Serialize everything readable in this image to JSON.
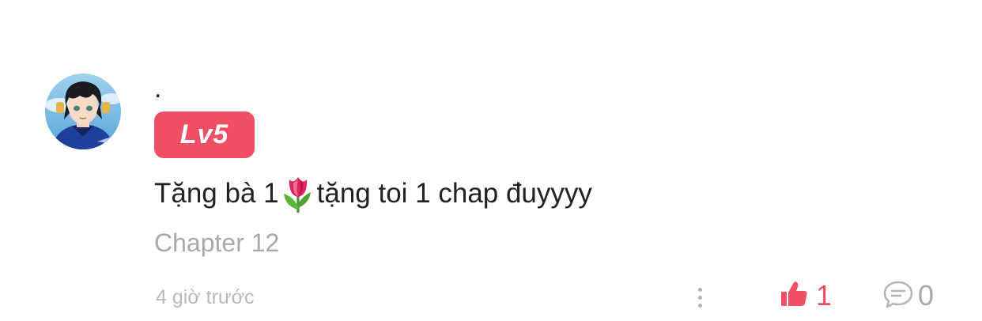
{
  "comment": {
    "avatar_icon": "user-avatar-anime-boy",
    "username": ".",
    "level_badge": "Lv5",
    "text_before_emoji": "Tặng bà 1",
    "emoji_icon": "tulip-icon",
    "text_after_emoji": "tặng toi 1 chap đuyyyy",
    "chapter": "Chapter 12",
    "timestamp": "4 giờ trước",
    "like_count": "1",
    "reply_count": "0"
  },
  "colors": {
    "accent": "#f04e65",
    "muted": "#a9a9a9"
  }
}
